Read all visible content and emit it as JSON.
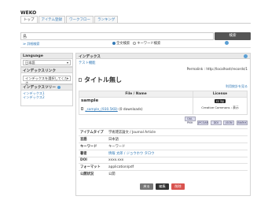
{
  "app": {
    "logo": "WEKO"
  },
  "tabs": [
    {
      "label": "トップ"
    },
    {
      "label": "アイテム登録"
    },
    {
      "label": "ワークフロー"
    },
    {
      "label": "ランキング"
    }
  ],
  "search": {
    "value": "島",
    "button_label": "検索",
    "advanced_link": "≫ 詳細検索"
  },
  "search_type": [
    {
      "label": "全文検索",
      "selected": true
    },
    {
      "label": "キーワード検索",
      "selected": false
    }
  ],
  "sidebar": {
    "language_title": "Language",
    "language_value": "日本語",
    "index_link_title": "インデックスリンク",
    "index_select_placeholder": "インデックスを選択してくださ",
    "index_tree_title": "インデックスツリー",
    "index_items": [
      "インデックス1",
      "インデックス2"
    ]
  },
  "main": {
    "panel_title": "インデックス",
    "breadcrumb_link": "テスト機能",
    "permalink": "Permalink : http://localhost/records/1",
    "item_title": "タイトル無し",
    "usage_link": "利用統計を見る",
    "file_table": {
      "headers": [
        "File / Name",
        "License"
      ],
      "file_label": "sample",
      "file_link": "_sample_(930.5KB)",
      "downloads": "(0 downloads)",
      "license_badge": "cc by",
      "license_text": "Creative Commons : 表示"
    },
    "export_buttons": [
      "OAI-PMH",
      "JPCOAR",
      "DDI",
      "JSON",
      "BibTeX"
    ],
    "metadata": [
      {
        "key": "アイテムタイプ",
        "value": "学術雑誌論文 / Journal Article"
      },
      {
        "key": "言語",
        "value": "日本語"
      },
      {
        "key": "キーワード",
        "value": "キーワード"
      },
      {
        "key": "著者",
        "value": "情報 太郎 / ジョウホウ タロウ"
      },
      {
        "key": "DOI",
        "value": "xxxx.xxx"
      },
      {
        "key": "フォーマット",
        "value": "application/pdf"
      },
      {
        "key": "公開状況",
        "value": "公開"
      }
    ],
    "buttons": {
      "back": "戻る",
      "edit": "編集",
      "delete": "削除"
    }
  },
  "colors": {
    "link": "#337ab7",
    "search_button": "#555555",
    "edit_button": "#333333",
    "delete_button": "#d9534f"
  }
}
